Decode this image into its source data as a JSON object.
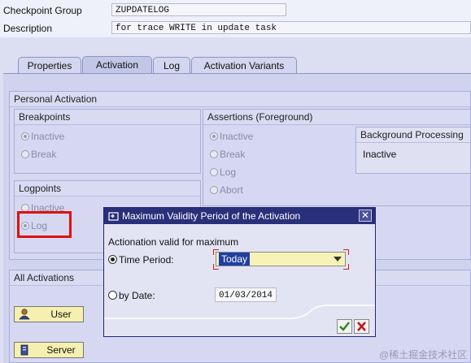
{
  "header": {
    "checkpoint_group_label": "Checkpoint Group",
    "checkpoint_group_value": "ZUPDATELOG",
    "description_label": "Description",
    "description_value": "for trace WRITE in update task"
  },
  "tabs": [
    {
      "label": "Properties",
      "active": false
    },
    {
      "label": "Activation",
      "active": true
    },
    {
      "label": "Log",
      "active": false
    },
    {
      "label": "Activation Variants",
      "active": false
    }
  ],
  "personal_activation": {
    "title": "Personal Activation",
    "breakpoints": {
      "title": "Breakpoints",
      "options": [
        "Inactive",
        "Break"
      ],
      "selected": "Inactive"
    },
    "logpoints": {
      "title": "Logpoints",
      "options": [
        "Inactive",
        "Log"
      ],
      "selected": "Log"
    },
    "assertions": {
      "title": "Assertions (Foreground)",
      "options": [
        "Inactive",
        "Break",
        "Log",
        "Abort"
      ],
      "selected": "Inactive"
    },
    "background": {
      "title": "Background Processing",
      "value": "Inactive"
    }
  },
  "all_activations": {
    "title": "All Activations",
    "user_button": "User",
    "server_button": "Server"
  },
  "dialog": {
    "title": "Maximum Validity Period of the Activation",
    "prompt": "Actionation valid for maximum",
    "time_period_label": "Time Period:",
    "time_period_value": "Today",
    "by_date_label": "by Date:",
    "date_value": "01/03/2014",
    "selected": "time_period"
  },
  "watermark": "@稀土掘金技术社区",
  "colors": {
    "highlight_box": "#e01010",
    "dialog_title_bar": "#2a2f7a",
    "button_yellow": "#f5f0b0"
  }
}
